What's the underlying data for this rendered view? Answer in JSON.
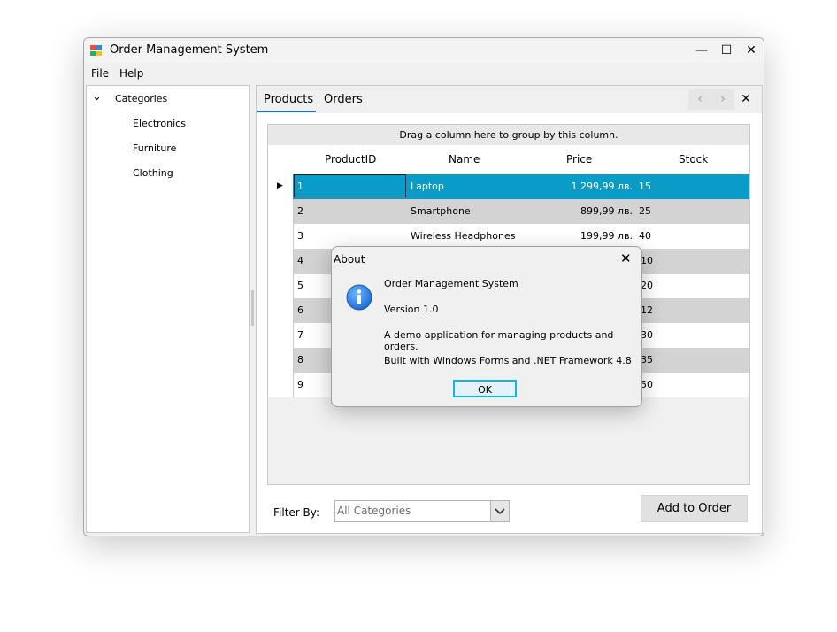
{
  "window": {
    "title": "Order Management System",
    "controls": {
      "minimize": "—",
      "maximize": "☐",
      "close": "✕"
    }
  },
  "menu": {
    "items": [
      "File",
      "Help"
    ]
  },
  "tree": {
    "root": "Categories",
    "root_expander": "⌄",
    "children": [
      "Electronics",
      "Furniture",
      "Clothing"
    ]
  },
  "tabs": {
    "items": [
      "Products",
      "Orders"
    ],
    "active": "Products",
    "nav": {
      "prev": "‹",
      "next": "›",
      "close": "✕"
    }
  },
  "grid": {
    "group_panel_text": "Drag a column here to group by this column.",
    "columns": [
      "ProductID",
      "Name",
      "Price",
      "Stock"
    ],
    "rows": [
      {
        "id": "1",
        "name": "Laptop",
        "price": "1 299,99 лв.",
        "stock": "15",
        "selected": true
      },
      {
        "id": "2",
        "name": "Smartphone",
        "price": "899,99 лв.",
        "stock": "25"
      },
      {
        "id": "3",
        "name": "Wireless Headphones",
        "price": "199,99 лв.",
        "stock": "40"
      },
      {
        "id": "4",
        "stock_visible": "10"
      },
      {
        "id": "5",
        "stock_visible": "20"
      },
      {
        "id": "6",
        "stock_visible": "12"
      },
      {
        "id": "7",
        "stock_visible": "30"
      },
      {
        "id": "8",
        "stock_visible": "35"
      },
      {
        "id": "9",
        "stock_visible": "50"
      }
    ],
    "selected_marker": "▶"
  },
  "filter": {
    "label": "Filter By:",
    "selected": "All Categories"
  },
  "add_button": "Add to Order",
  "about_dialog": {
    "title": "About",
    "close": "✕",
    "lines": [
      "Order Management System",
      "Version 1.0",
      "A demo application for managing products and orders.",
      "Built with Windows Forms and .NET Framework 4.8"
    ],
    "ok": "OK"
  },
  "colors": {
    "selection": "#0a9cc8",
    "alt_row": "#d3d3d3",
    "tab_underline": "#1a73c9",
    "ok_focus": "#0fb7e6",
    "info_icon": "#1e6fd0"
  }
}
